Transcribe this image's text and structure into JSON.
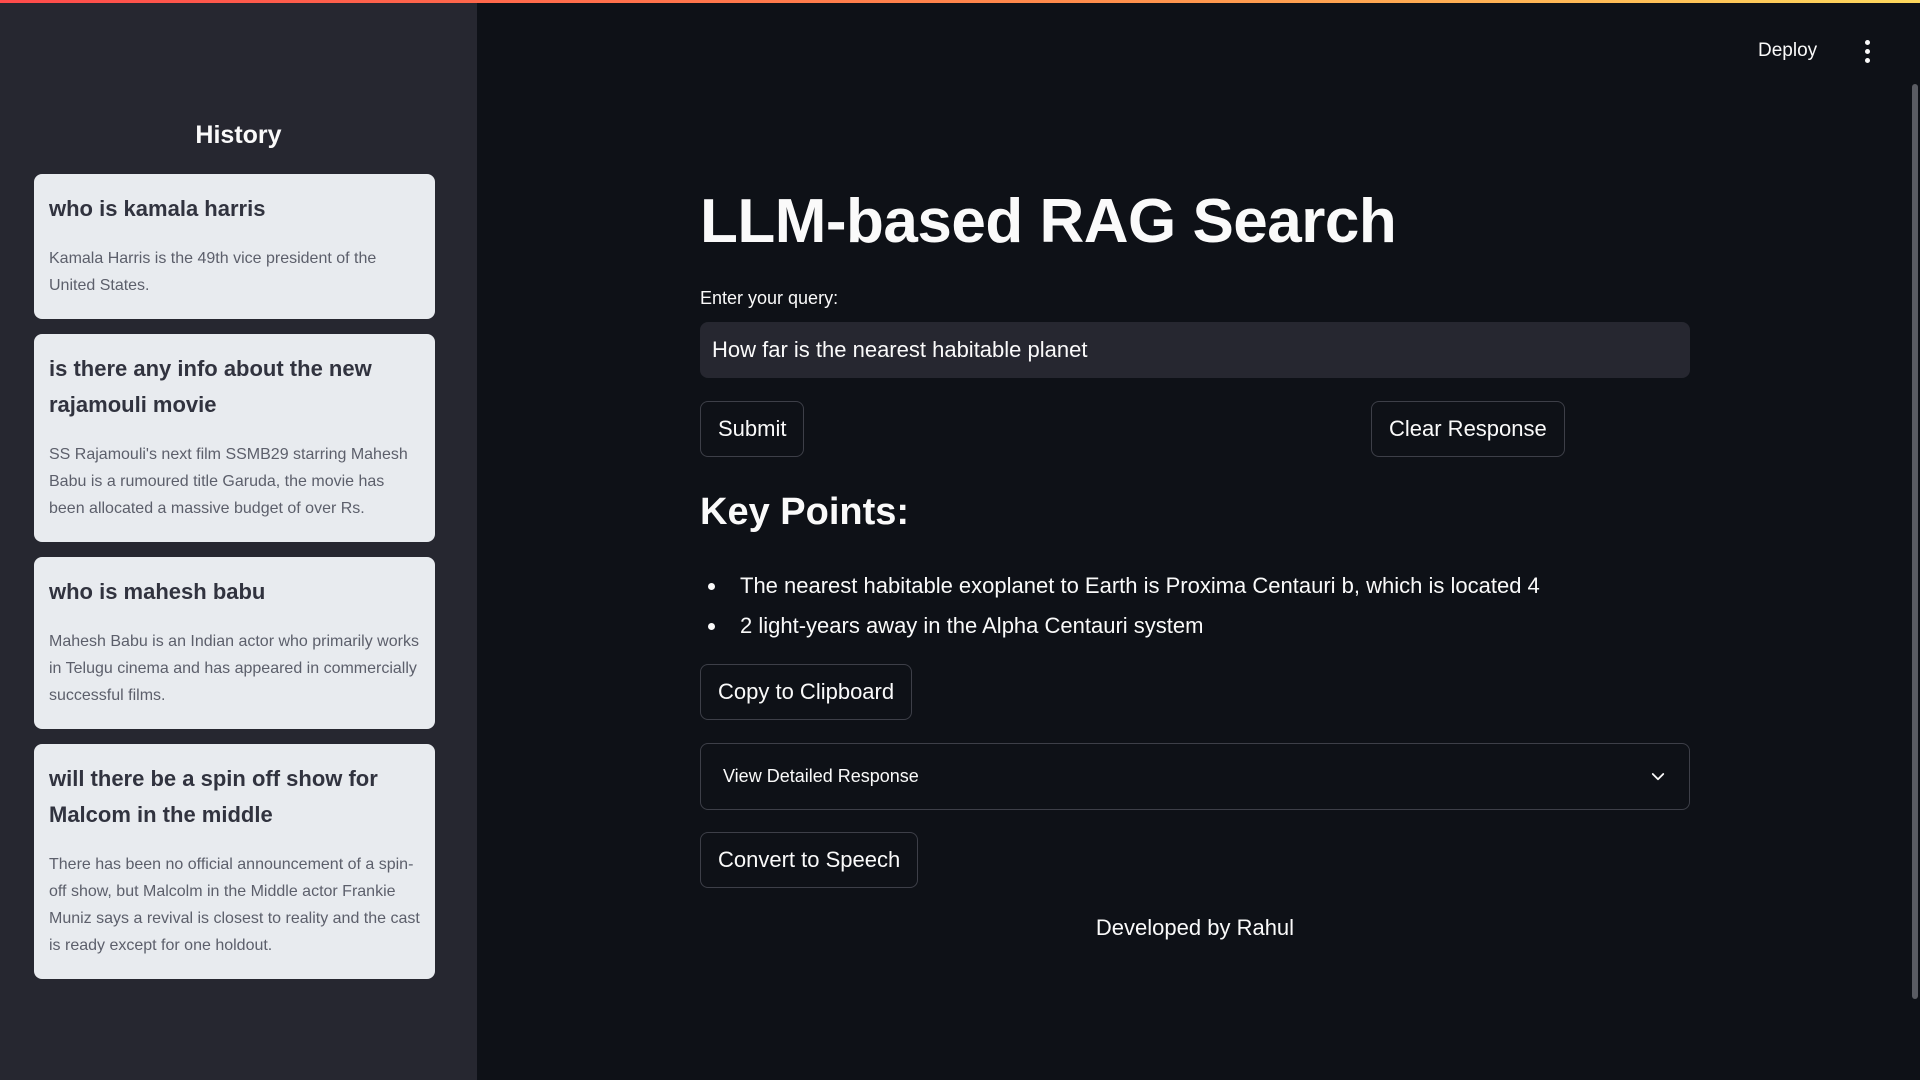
{
  "header": {
    "deploy_label": "Deploy",
    "menu_icon": "kebab-menu-icon",
    "accent_gradient": [
      "#ff4b4b",
      "#ff8a4b",
      "#fdd85d"
    ]
  },
  "sidebar": {
    "title": "History",
    "items": [
      {
        "query": "who is kamala harris",
        "answer": "Kamala Harris is the 49th vice president of the United States."
      },
      {
        "query": "is there any info about the new rajamouli movie",
        "answer": "SS Rajamouli's next film SSMB29 starring Mahesh Babu is a rumoured title Garuda, the movie has been allocated a massive budget of over Rs."
      },
      {
        "query": "who is mahesh babu",
        "answer": "Mahesh Babu is an Indian actor who primarily works in Telugu cinema and has appeared in commercially successful films."
      },
      {
        "query": "will there be a spin off show for Malcom in the middle",
        "answer": "There has been no official announcement of a spin-off show, but Malcolm in the Middle actor Frankie Muniz says a revival is closest to reality and the cast is ready except for one holdout."
      }
    ]
  },
  "main": {
    "title": "LLM-based RAG Search",
    "query_label": "Enter your query:",
    "query_value": "How far is the nearest habitable planet",
    "submit_label": "Submit",
    "clear_label": "Clear Response",
    "key_points_title": "Key Points:",
    "key_points": [
      "The nearest habitable exoplanet to Earth is Proxima Centauri b, which is located 4",
      "2 light-years away in the Alpha Centauri system"
    ],
    "copy_label": "Copy to Clipboard",
    "expander_label": "View Detailed Response",
    "expander_icon": "chevron-down-icon",
    "speech_label": "Convert to Speech",
    "footer": "Developed by Rahul"
  },
  "colors": {
    "background": "#0e1117",
    "sidebar": "#262730",
    "card": "#e8ebef",
    "text": "#fafafa",
    "border": "#3d3f48"
  }
}
